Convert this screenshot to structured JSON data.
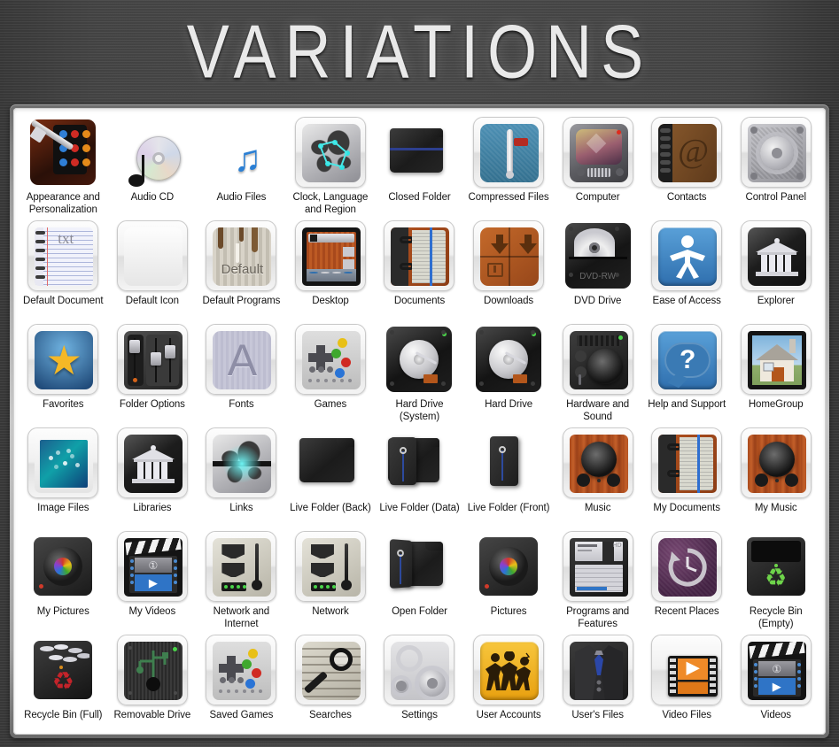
{
  "header": {
    "title": "VARIATIONS"
  },
  "panel": {
    "columns": 9,
    "rows": 6,
    "icons": [
      {
        "label": "Appearance and Personalization",
        "art": "paint-palette"
      },
      {
        "label": "Audio CD",
        "art": "compact-disc"
      },
      {
        "label": "Audio Files",
        "art": "music-note"
      },
      {
        "label": "Clock, Language and Region",
        "art": "world-map"
      },
      {
        "label": "Closed Folder",
        "art": "closed-folder"
      },
      {
        "label": "Compressed Files",
        "art": "thermometer"
      },
      {
        "label": "Computer",
        "art": "retro-tv"
      },
      {
        "label": "Contacts",
        "art": "address-book"
      },
      {
        "label": "Control Panel",
        "art": "gears-plate"
      },
      {
        "label": "Default Document",
        "art": "txt-notepad"
      },
      {
        "label": "Default Icon",
        "art": "blank-tile"
      },
      {
        "label": "Default Programs",
        "art": "paint-drip"
      },
      {
        "label": "Desktop",
        "art": "desktop-window"
      },
      {
        "label": "Documents",
        "art": "ring-notebook"
      },
      {
        "label": "Downloads",
        "art": "down-arrows"
      },
      {
        "label": "DVD Drive",
        "art": "dvd-drive"
      },
      {
        "label": "Ease of Access",
        "art": "accessibility-person"
      },
      {
        "label": "Explorer",
        "art": "classical-building"
      },
      {
        "label": "Favorites",
        "art": "gold-star"
      },
      {
        "label": "Folder Options",
        "art": "mixer-sliders"
      },
      {
        "label": "Fonts",
        "art": "letter-a"
      },
      {
        "label": "Games",
        "art": "gamepad"
      },
      {
        "label": "Hard Drive (System)",
        "art": "hard-disk"
      },
      {
        "label": "Hard Drive",
        "art": "hard-disk"
      },
      {
        "label": "Hardware and Sound",
        "art": "audio-hardware"
      },
      {
        "label": "Help and Support",
        "art": "question-bubble"
      },
      {
        "label": "HomeGroup",
        "art": "house"
      },
      {
        "label": "Image Files",
        "art": "photo-frame"
      },
      {
        "label": "Libraries",
        "art": "classical-building"
      },
      {
        "label": "Links",
        "art": "network-burst"
      },
      {
        "label": "Live Folder (Back)",
        "art": "folder-back"
      },
      {
        "label": "Live Folder (Data)",
        "art": "folder-data"
      },
      {
        "label": "Live Folder (Front)",
        "art": "folder-front"
      },
      {
        "label": "Music",
        "art": "wood-speaker"
      },
      {
        "label": "My Documents",
        "art": "ring-notebook"
      },
      {
        "label": "My Music",
        "art": "wood-speaker"
      },
      {
        "label": "My Pictures",
        "art": "camera-lens"
      },
      {
        "label": "My Videos",
        "art": "clapperboard"
      },
      {
        "label": "Network and Internet",
        "art": "network-antenna"
      },
      {
        "label": "Network",
        "art": "network-antenna"
      },
      {
        "label": "Open Folder",
        "art": "open-folder"
      },
      {
        "label": "Pictures",
        "art": "camera-lens"
      },
      {
        "label": "Programs and Features",
        "art": "floppy-disk"
      },
      {
        "label": "Recent Places",
        "art": "clock-back"
      },
      {
        "label": "Recycle Bin (Empty)",
        "art": "recycle-empty"
      },
      {
        "label": "Recycle Bin (Full)",
        "art": "recycle-full"
      },
      {
        "label": "Removable Drive",
        "art": "usb-drive"
      },
      {
        "label": "Saved Games",
        "art": "gamepad"
      },
      {
        "label": "Searches",
        "art": "magnifier"
      },
      {
        "label": "Settings",
        "art": "gears-plain"
      },
      {
        "label": "User Accounts",
        "art": "people-group"
      },
      {
        "label": "User's Files",
        "art": "suit-tie"
      },
      {
        "label": "Video Files",
        "art": "orange-film"
      },
      {
        "label": "Videos",
        "art": "clapperboard"
      }
    ]
  },
  "colors": {
    "background_dark": "#464646",
    "panel_background": "#ffffff",
    "title_text": "#e9e9e9",
    "label_text": "#141414",
    "accent_blue": "#2d4a9e",
    "accent_orange": "#dd6a10",
    "accent_gold": "#f5b826",
    "accent_green": "#5fbb2e",
    "accent_red": "#c4232a"
  }
}
